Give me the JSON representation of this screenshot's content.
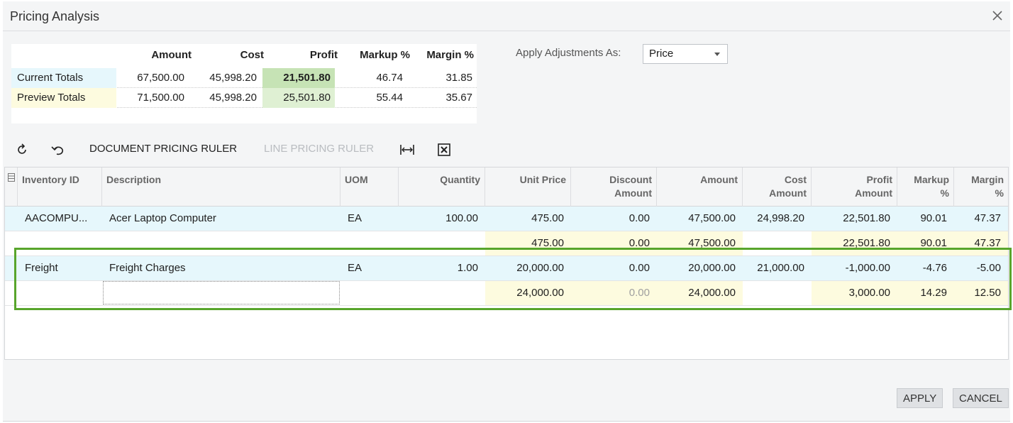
{
  "dialog": {
    "title": "Pricing Analysis"
  },
  "totals": {
    "headers": [
      "",
      "Amount",
      "Cost",
      "Profit",
      "Markup %",
      "Margin %"
    ],
    "rows": [
      {
        "label": "Current Totals",
        "amount": "67,500.00",
        "cost": "45,998.20",
        "profit": "21,501.80",
        "markup": "46.74",
        "margin": "31.85"
      },
      {
        "label": "Preview Totals",
        "amount": "71,500.00",
        "cost": "45,998.20",
        "profit": "25,501.80",
        "markup": "55.44",
        "margin": "35.67"
      }
    ]
  },
  "adjustments": {
    "label": "Apply Adjustments As:",
    "value": "Price"
  },
  "toolbar": {
    "refresh_icon": "refresh-icon",
    "undo_icon": "undo-icon",
    "document_ruler": "DOCUMENT PRICING RULER",
    "line_ruler": "LINE PRICING RULER",
    "fit_icon": "fit-columns-icon",
    "excel_icon": "excel-export-icon"
  },
  "grid": {
    "columns": {
      "inventory_id": "Inventory ID",
      "description": "Description",
      "uom": "UOM",
      "quantity": "Quantity",
      "unit_price": "Unit Price",
      "discount_l1": "Discount",
      "discount_l2": "Amount",
      "amount": "Amount",
      "cost_l1": "Cost",
      "cost_l2": "Amount",
      "profit_l1": "Profit",
      "profit_l2": "Amount",
      "markup_l1": "Markup",
      "markup_l2": "%",
      "margin_l1": "Margin",
      "margin_l2": "%"
    },
    "rows": [
      {
        "inventory_id": "AACOMPU...",
        "description": "Acer Laptop Computer",
        "uom": "EA",
        "quantity": "100.00",
        "unit_price": "475.00",
        "discount": "0.00",
        "amount": "47,500.00",
        "cost": "24,998.20",
        "profit": "22,501.80",
        "markup": "90.01",
        "margin": "47.37"
      },
      {
        "inventory_id": "",
        "description": "",
        "uom": "",
        "quantity": "",
        "unit_price": "475.00",
        "discount": "0.00",
        "amount": "47,500.00",
        "cost": "",
        "profit": "22,501.80",
        "markup": "90.01",
        "margin": "47.37"
      },
      {
        "inventory_id": "Freight",
        "description": "Freight Charges",
        "uom": "EA",
        "quantity": "1.00",
        "unit_price": "20,000.00",
        "discount": "0.00",
        "amount": "20,000.00",
        "cost": "21,000.00",
        "profit": "-1,000.00",
        "markup": "-4.76",
        "margin": "-5.00"
      },
      {
        "inventory_id": "",
        "description": "",
        "uom": "",
        "quantity": "",
        "unit_price": "24,000.00",
        "discount": "0.00",
        "amount": "24,000.00",
        "cost": "",
        "profit": "3,000.00",
        "markup": "14.29",
        "margin": "12.50"
      }
    ]
  },
  "buttons": {
    "apply": "APPLY",
    "cancel": "CANCEL"
  },
  "colors": {
    "highlight_border": "#58a52c",
    "profit_current": "#c6e3b5",
    "profit_preview": "#dff0d3",
    "current_row": "#e6f7fc",
    "preview_row": "#fdfbdf"
  }
}
